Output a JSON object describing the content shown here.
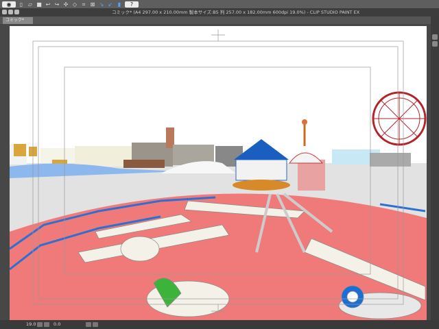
{
  "toolbar": {
    "icons": [
      "view-icon",
      "new-icon",
      "open-icon",
      "save-icon",
      "undo-icon",
      "redo-icon",
      "transform-icon",
      "ruler-icon",
      "help-icon"
    ]
  },
  "window": {
    "title": "コミック* (A4 297.00 x 210.00mm 製本サイズ:B5 判 257.00 x 182.00mm 600dpi 19.0%)  - CLIP STUDIO PAINT EX"
  },
  "tab": {
    "label": "コミック*"
  },
  "status": {
    "zoom": "19.0",
    "angle": "0.0"
  },
  "colors": {
    "platform": "#f07a7a",
    "railing": "#2f6fd0",
    "accent_green": "#3cb43c"
  }
}
